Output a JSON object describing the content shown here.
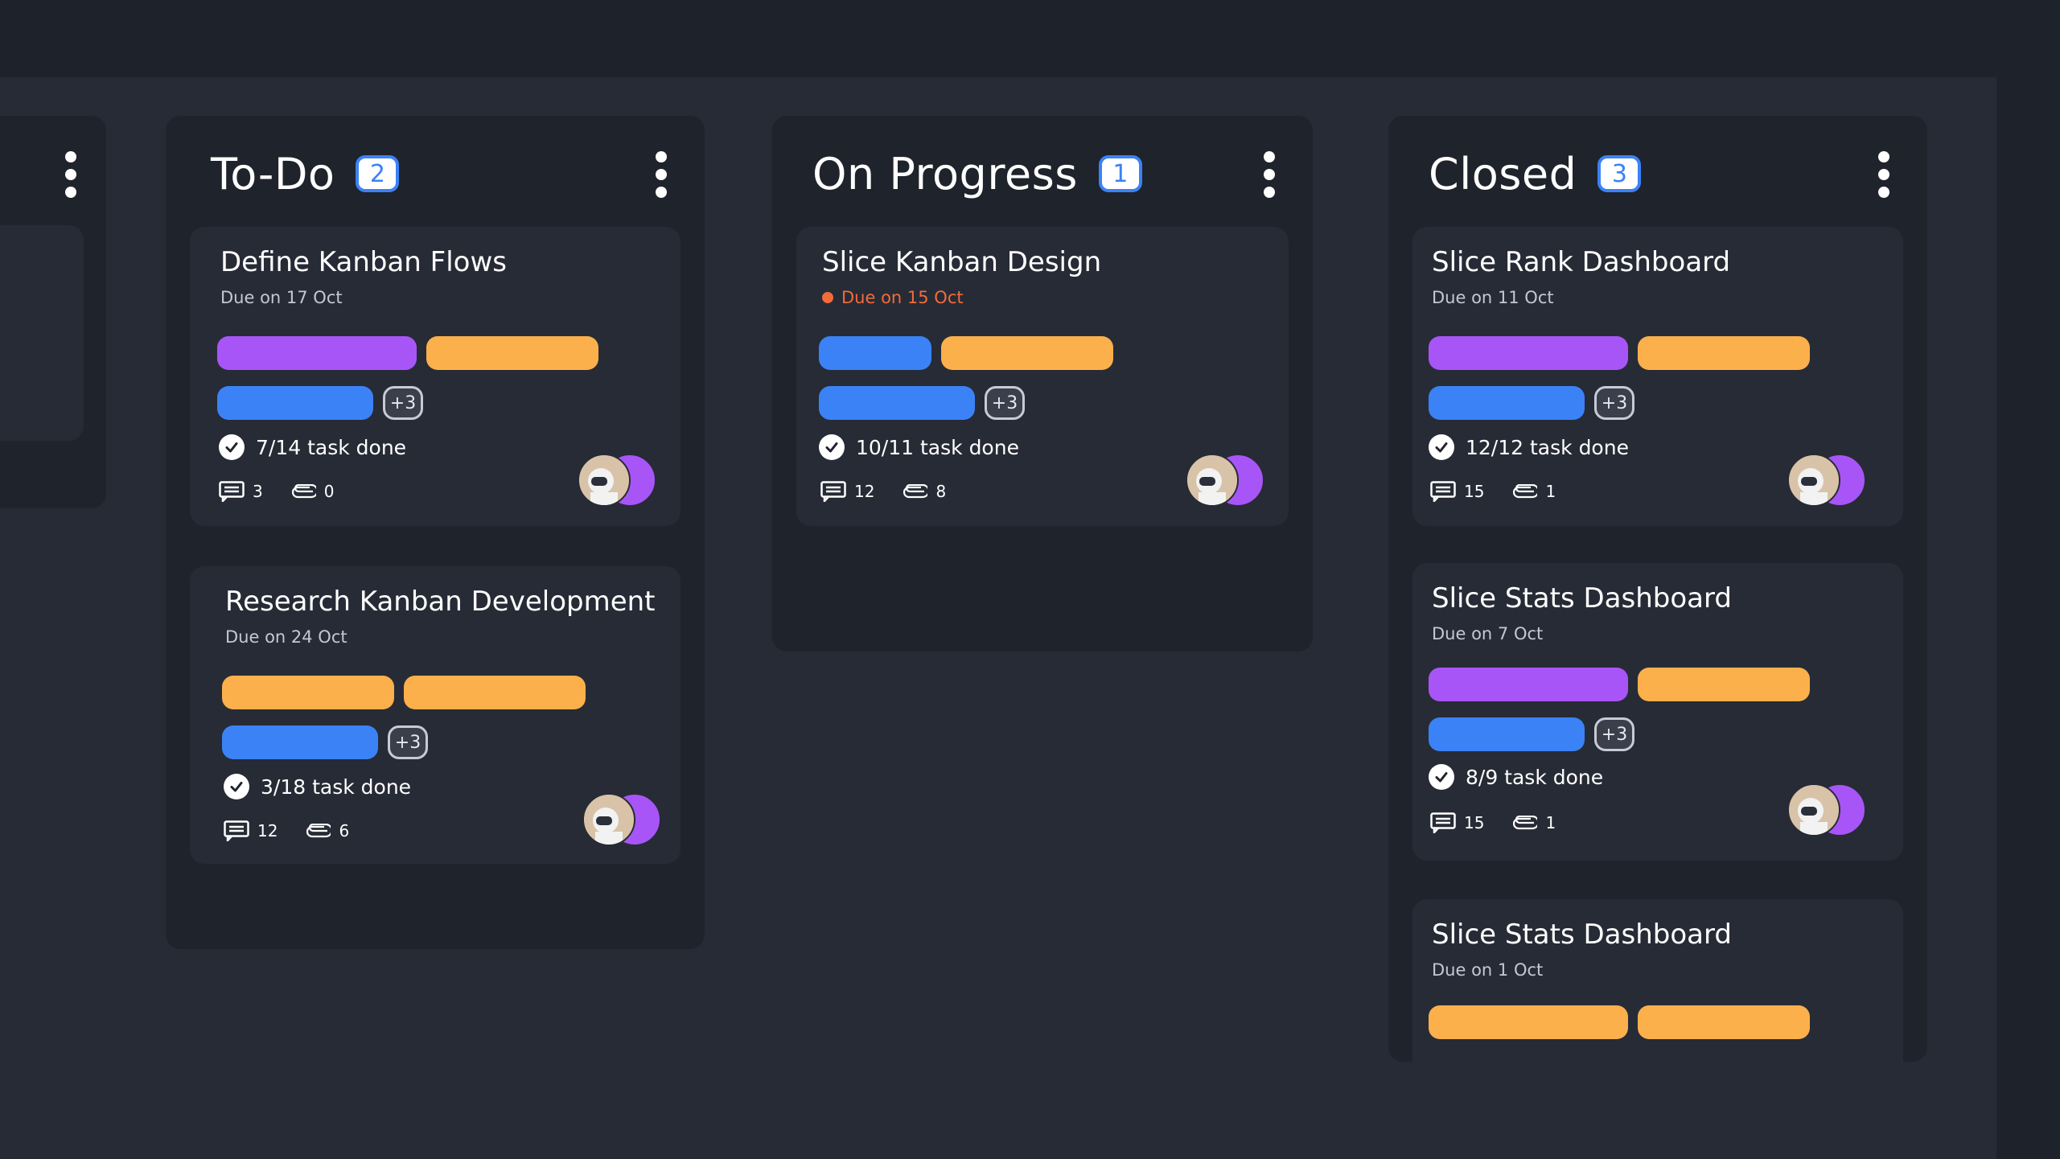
{
  "colors": {
    "background": "#1e222a",
    "board": "#272b36",
    "column": "#1f232b",
    "card": "#272b36",
    "accent_blue": "#3b82f6",
    "tag_purple": "#a855f7",
    "tag_orange": "#fbb04b",
    "tag_blue": "#3b82f6",
    "overdue": "#f26b3a"
  },
  "icons": {
    "menu": "kebab-menu-icon",
    "check": "check-circle-icon",
    "comment": "comment-icon",
    "attachment": "paperclip-icon",
    "avatar": "user-avatar"
  },
  "columns": [
    {
      "title": "To-Do",
      "count": "2",
      "cards": [
        {
          "title": "Define Kanban Flows",
          "due": "Due on 17 Oct",
          "overdue": false,
          "tags_row1": [
            "purple",
            "orange"
          ],
          "tags_row2": [
            "blue"
          ],
          "more": "+3",
          "progress": "7/14 task done",
          "comments": "3",
          "attachments": "0"
        },
        {
          "title": "Research Kanban Development",
          "due": "Due on 24 Oct",
          "overdue": false,
          "tags_row1": [
            "orange",
            "orange"
          ],
          "tags_row2": [
            "blue"
          ],
          "more": "+3",
          "progress": "3/18 task done",
          "comments": "12",
          "attachments": "6"
        }
      ]
    },
    {
      "title": "On Progress",
      "count": "1",
      "cards": [
        {
          "title": "Slice Kanban Design",
          "due": "Due on 15 Oct",
          "overdue": true,
          "tags_row1": [
            "blue",
            "orange"
          ],
          "tags_row2": [
            "blue"
          ],
          "more": "+3",
          "progress": "10/11 task done",
          "comments": "12",
          "attachments": "8"
        }
      ]
    },
    {
      "title": "Closed",
      "count": "3",
      "cards": [
        {
          "title": "Slice Rank Dashboard",
          "due": "Due on 11 Oct",
          "overdue": false,
          "tags_row1": [
            "purple",
            "orange"
          ],
          "tags_row2": [
            "blue"
          ],
          "more": "+3",
          "progress": "12/12 task done",
          "comments": "15",
          "attachments": "1"
        },
        {
          "title": "Slice Stats Dashboard",
          "due": "Due on 7 Oct",
          "overdue": false,
          "tags_row1": [
            "purple",
            "orange"
          ],
          "tags_row2": [
            "blue"
          ],
          "more": "+3",
          "progress": "8/9 task done",
          "comments": "15",
          "attachments": "1"
        },
        {
          "title": "Slice Stats Dashboard",
          "due": "Due on 1 Oct",
          "overdue": false,
          "tags_row1": [
            "orange",
            "orange"
          ]
        }
      ]
    }
  ]
}
